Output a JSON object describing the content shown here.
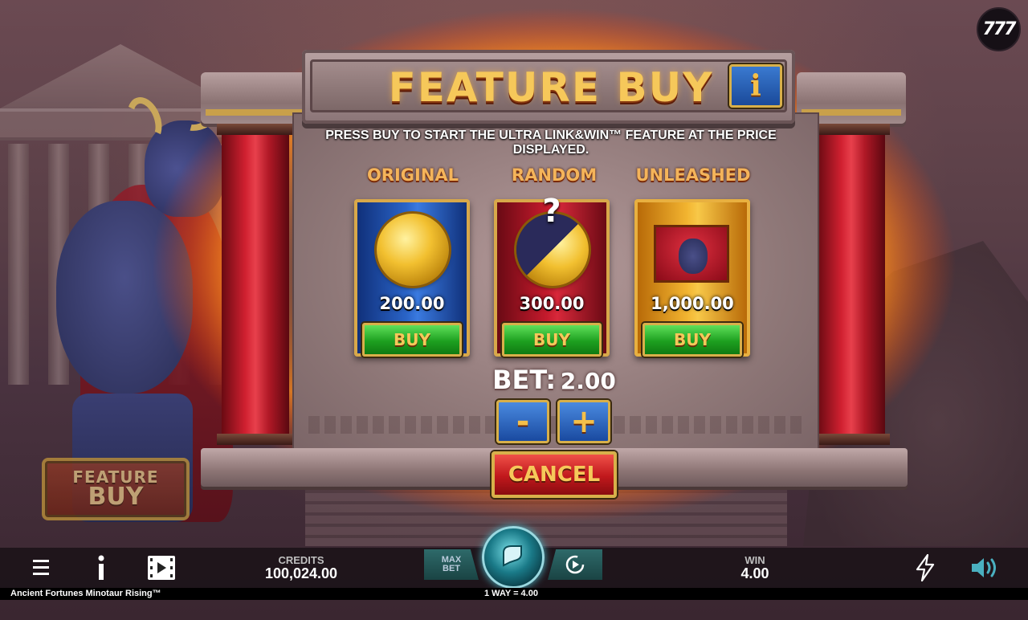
{
  "logo": "777",
  "dialog": {
    "title": "FEATURE BUY",
    "info_label": "i",
    "instructions": "PRESS BUY TO START THE ULTRA LINK&WIN™ FEATURE AT THE PRICE DISPLAYED.",
    "options": [
      {
        "label": "ORIGINAL",
        "price": "200.00",
        "buy_label": "BUY",
        "color": "#2a64c8"
      },
      {
        "label": "RANDOM",
        "price": "300.00",
        "buy_label": "BUY",
        "mystery": "?",
        "color": "#c41a2c"
      },
      {
        "label": "UNLEASHED",
        "price": "1,000.00",
        "buy_label": "BUY",
        "color": "#f2b430"
      }
    ],
    "bet_label": "BET:",
    "bet_value": "2.00",
    "decrease_label": "-",
    "increase_label": "+",
    "cancel_label": "CANCEL"
  },
  "side_button": {
    "line1": "FEATURE",
    "line2": "BUY"
  },
  "hud": {
    "menu_icon": "menu-icon",
    "info_icon": "info-icon",
    "video_icon": "video-icon",
    "credits_label": "CREDITS",
    "credits_value": "100,024.00",
    "maxbet_line1": "MAX",
    "maxbet_line2": "BET",
    "spin_icon": "spin-icon",
    "autoplay_icon": "autoplay-icon",
    "win_label": "WIN",
    "win_value": "4.00",
    "turbo_icon": "lightning-icon",
    "sound_icon": "speaker-icon"
  },
  "footer": {
    "game_name": "Ancient Fortunes Minotaur Rising™",
    "ways": "1 WAY = 4.00"
  }
}
